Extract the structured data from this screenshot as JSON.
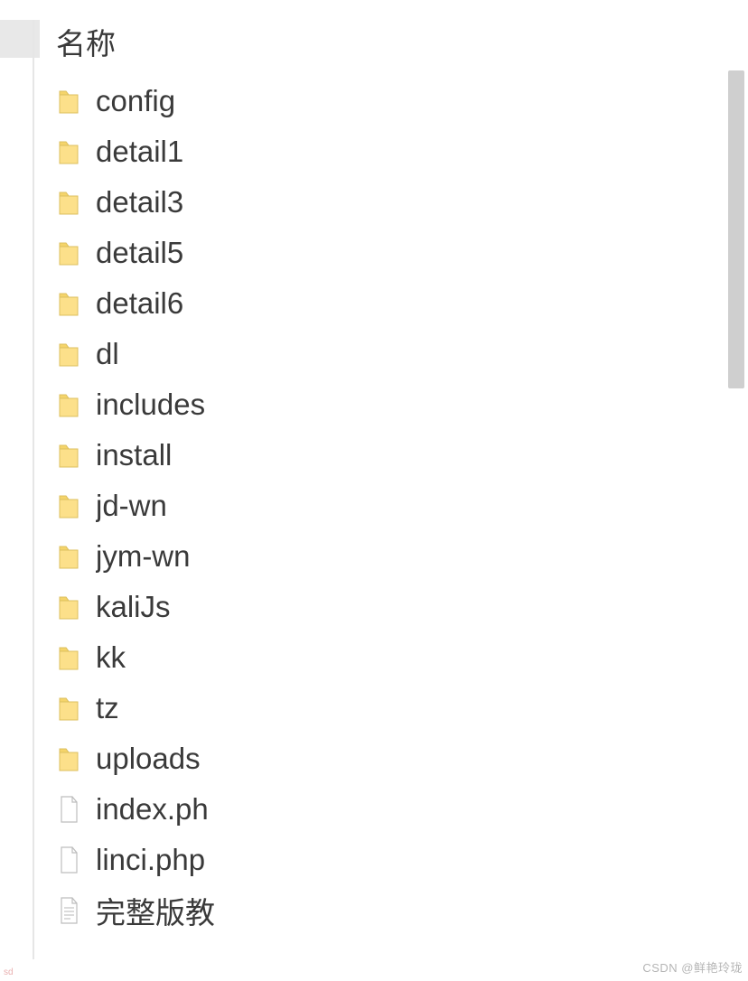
{
  "header": {
    "name_col": "名称"
  },
  "items": [
    {
      "type": "folder",
      "name": "config"
    },
    {
      "type": "folder",
      "name": "detail1"
    },
    {
      "type": "folder",
      "name": "detail3"
    },
    {
      "type": "folder",
      "name": "detail5"
    },
    {
      "type": "folder",
      "name": "detail6"
    },
    {
      "type": "folder",
      "name": "dl"
    },
    {
      "type": "folder",
      "name": "includes"
    },
    {
      "type": "folder",
      "name": "install"
    },
    {
      "type": "folder",
      "name": "jd-wn"
    },
    {
      "type": "folder",
      "name": "jym-wn"
    },
    {
      "type": "folder",
      "name": "kaliJs"
    },
    {
      "type": "folder",
      "name": "kk"
    },
    {
      "type": "folder",
      "name": "tz"
    },
    {
      "type": "folder",
      "name": "uploads"
    },
    {
      "type": "file",
      "name": "index.ph"
    },
    {
      "type": "file",
      "name": "linci.php"
    },
    {
      "type": "textfile",
      "name": "完整版教"
    }
  ],
  "watermark": {
    "left": "sd",
    "right": "CSDN @鲜艳玲珑"
  }
}
